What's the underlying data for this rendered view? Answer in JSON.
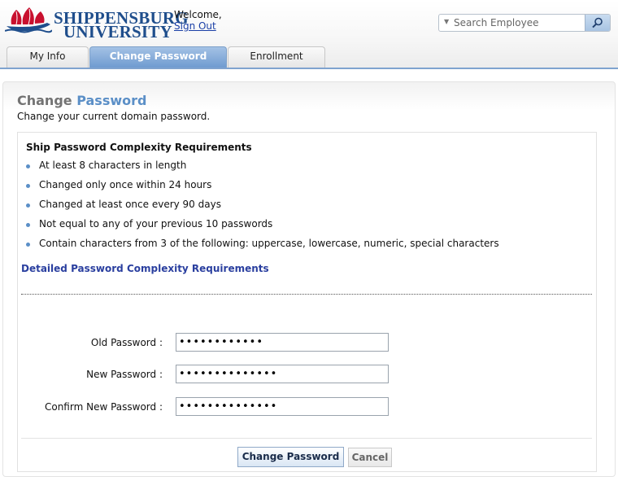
{
  "header": {
    "logo_line1": "SHIPPENSBURG",
    "logo_line2": "UNIVERSITY",
    "welcome": "Welcome,",
    "signout": "Sign Out",
    "search_placeholder": "Search Employee"
  },
  "tabs": [
    {
      "label": "My Info",
      "active": false
    },
    {
      "label": "Change Password",
      "active": true
    },
    {
      "label": "Enrollment",
      "active": false
    }
  ],
  "page": {
    "title_part1": "Change",
    "title_part2": "Password",
    "subtitle": "Change your current domain password."
  },
  "requirements": {
    "heading": "Ship Password Complexity Requirements",
    "items": [
      "At least 8 characters in length",
      "Changed only once within 24 hours",
      "Changed at least once every 90 days",
      "Not equal to any of your previous 10 passwords",
      "Contain characters from 3 of the following: uppercase, lowercase, numeric, special characters"
    ],
    "detail_link": "Detailed Password Complexity Requirements"
  },
  "form": {
    "old_label": "Old Password :",
    "old_value": "••••••••••••",
    "new_label": "New Password :",
    "new_value": "••••••••••••••",
    "confirm_label": "Confirm New Password :",
    "confirm_value": "••••••••••••••",
    "submit_label": "Change Password",
    "cancel_label": "Cancel"
  },
  "colors": {
    "brand_blue": "#1f4e8c",
    "tab_active": "#6f9bd0",
    "accent_title": "#5b8fc7",
    "link": "#2a3f9f"
  }
}
